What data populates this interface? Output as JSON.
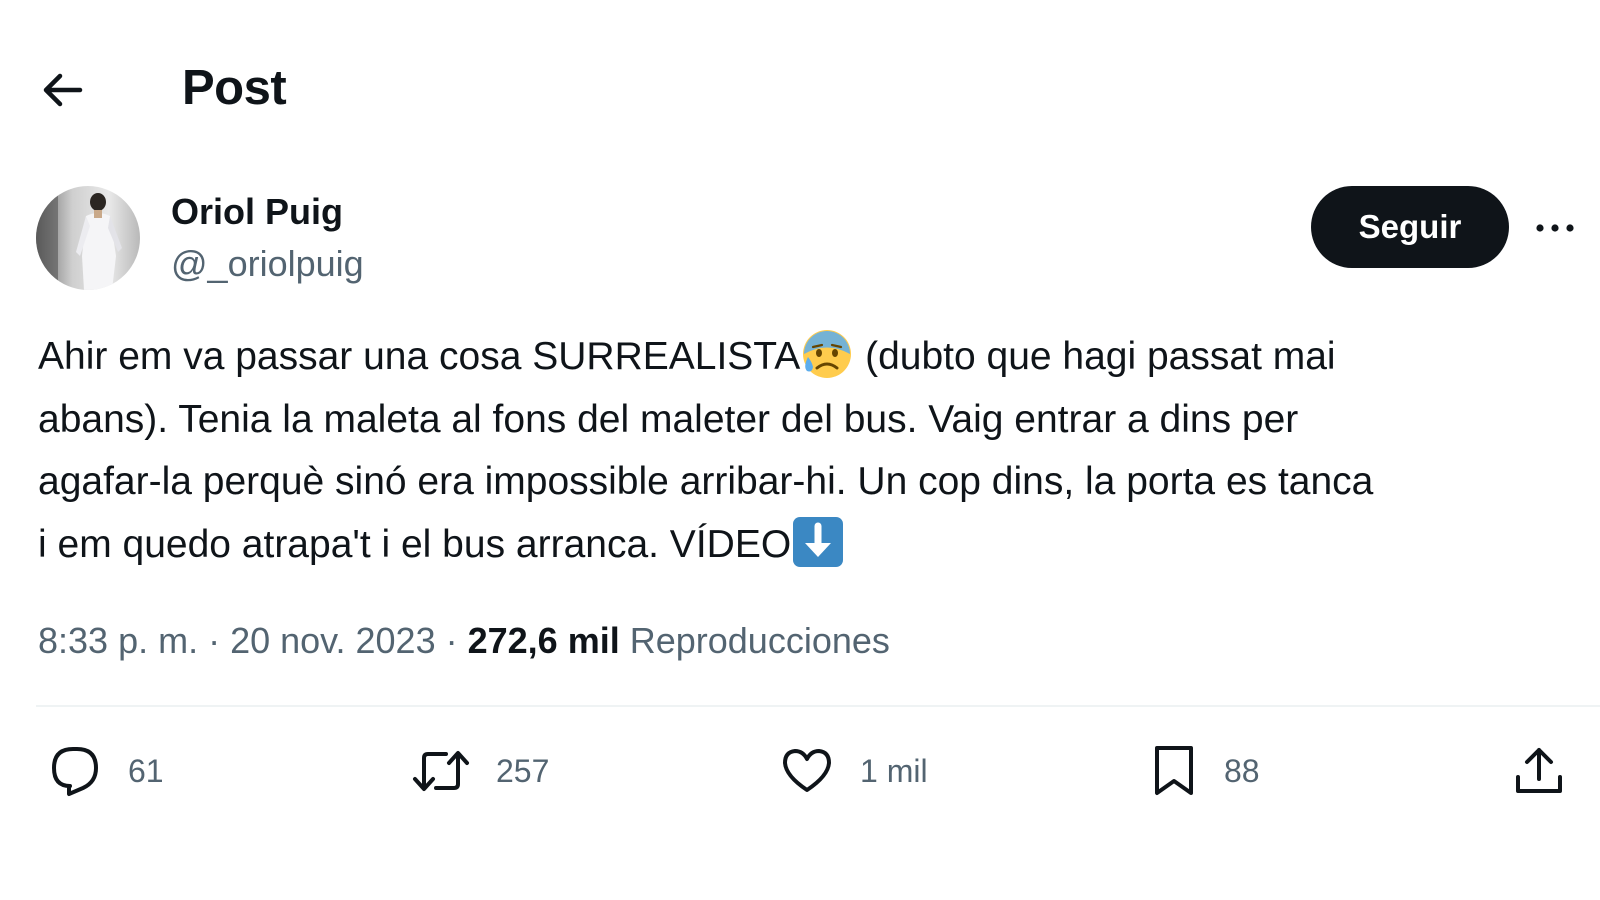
{
  "header": {
    "title": "Post",
    "back_icon": "arrow-left-icon"
  },
  "author": {
    "display_name": "Oriol Puig",
    "handle": "@_oriolpuig",
    "follow_label": "Seguir",
    "more_icon": "more-horizontal-icon"
  },
  "tweet": {
    "line1_a": "Ahir em va passar una cosa SURREALISTA",
    "line1_emoji": "anxious-face-with-sweat-emoji",
    "line1_b": " (dubto que hagi passat mai",
    "line2": "abans). Tenia la maleta al fons del maleter del bus. Vaig entrar a dins per",
    "line3": "agafar-la perquè sinó era impossible arribar-hi. Un cop dins, la porta es tanca",
    "line4_a": "i em quedo atrapa't i el bus arranca. VÍDEO",
    "line4_emoji": "down-arrow-emoji"
  },
  "meta": {
    "time": "8:33 p. m.",
    "sep1": " · ",
    "date": "20 nov. 2023",
    "sep2": " · ",
    "views_count": "272,6 mil",
    "views_label": "Reproducciones"
  },
  "actions": {
    "replies": "61",
    "reposts": "257",
    "likes": "1 mil",
    "bookmarks": "88"
  },
  "colors": {
    "text_primary": "#0f1419",
    "text_secondary": "#536471",
    "follow_bg": "#0f1419",
    "divider": "#eff3f4",
    "emoji_arrow_bg": "#3b88c3"
  }
}
